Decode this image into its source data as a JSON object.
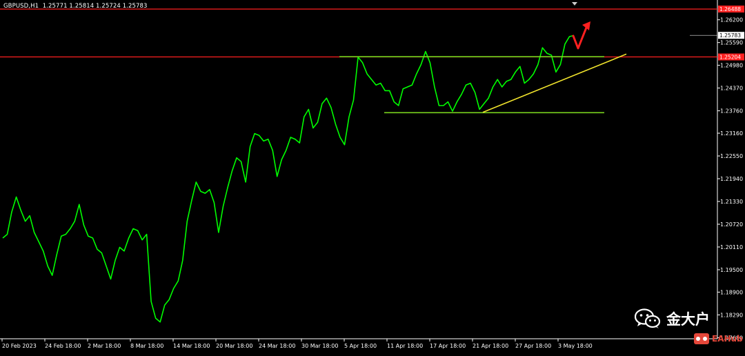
{
  "header": {
    "symbol": "GBPUSD",
    "timeframe": "H1",
    "ohlc": "1.25771 1.25814 1.25724 1.25783"
  },
  "watermark": {
    "main_text": "金大户",
    "sub_text": "EAHub",
    "icon": "wechat-icon"
  },
  "colors": {
    "background": "#000000",
    "price_line": "#00ff00",
    "support_resistance": "#7ad41e",
    "trendline": "#f0e32c",
    "level_line": "#ff2020",
    "arrow": "#ff2020",
    "axis_text": "#ffffff"
  },
  "chart_data": {
    "type": "line",
    "title": "GBPUSD,H1",
    "xlabel": "",
    "ylabel": "",
    "ylim": [
      1.1765,
      1.2649
    ],
    "grid": false,
    "y_ticks": [
      "1.26200",
      "1.25590",
      "1.24980",
      "1.24370",
      "1.23760",
      "1.23160",
      "1.22550",
      "1.21940",
      "1.21330",
      "1.20720",
      "1.20110",
      "1.19500",
      "1.18900",
      "1.18290",
      "1.17680"
    ],
    "x_ticks": [
      "20 Feb 2023",
      "24 Feb 18:00",
      "2 Mar 18:00",
      "8 Mar 18:00",
      "14 Mar 18:00",
      "20 Mar 18:00",
      "24 Mar 18:00",
      "30 Mar 18:00",
      "5 Apr 18:00",
      "11 Apr 18:00",
      "17 Apr 18:00",
      "21 Apr 18:00",
      "27 Apr 18:00",
      "3 May 18:00"
    ],
    "price_labels": [
      {
        "value": 1.26488,
        "text": "1.26488",
        "color": "#ff2020"
      },
      {
        "value": 1.25783,
        "text": "1.25783",
        "color": "#ffffff"
      },
      {
        "value": 1.25204,
        "text": "1.25204",
        "color": "#ff2020"
      }
    ],
    "series": [
      {
        "values": [
          1.2035,
          1.2045,
          1.2105,
          1.2145,
          1.211,
          1.208,
          1.2095,
          1.205,
          1.2025,
          1.2,
          1.196,
          1.1935,
          1.199,
          1.204,
          1.2045,
          1.206,
          1.208,
          1.2125,
          1.207,
          1.204,
          1.2035,
          1.2005,
          1.1995,
          1.196,
          1.1925,
          1.1975,
          1.201,
          1.2,
          1.2035,
          1.206,
          1.2055,
          1.203,
          1.2045,
          1.1865,
          1.182,
          1.181,
          1.1855,
          1.187,
          1.19,
          1.192,
          1.1975,
          1.208,
          1.2135,
          1.2185,
          1.216,
          1.2155,
          1.2165,
          1.213,
          1.205,
          1.212,
          1.217,
          1.2215,
          1.225,
          1.224,
          1.2185,
          1.228,
          1.2315,
          1.231,
          1.2295,
          1.23,
          1.227,
          1.22,
          1.2245,
          1.227,
          1.2305,
          1.23,
          1.229,
          1.236,
          1.238,
          1.233,
          1.2345,
          1.2395,
          1.241,
          1.2385,
          1.234,
          1.2305,
          1.2285,
          1.236,
          1.2405,
          1.252,
          1.2505,
          1.2475,
          1.246,
          1.2445,
          1.245,
          1.243,
          1.243,
          1.24,
          1.239,
          1.2435,
          1.244,
          1.2445,
          1.2475,
          1.25,
          1.2535,
          1.2505,
          1.244,
          1.239,
          1.239,
          1.24,
          1.2375,
          1.24,
          1.242,
          1.2445,
          1.245,
          1.2425,
          1.238,
          1.2395,
          1.241,
          1.244,
          1.246,
          1.244,
          1.2455,
          1.246,
          1.248,
          1.2495,
          1.245,
          1.246,
          1.2475,
          1.25,
          1.2545,
          1.253,
          1.2525,
          1.248,
          1.25,
          1.2555,
          1.2575,
          1.2578
        ]
      }
    ],
    "annotations": {
      "resistance_line": {
        "x_start": 1.25,
        "x_end": 2.1,
        "y": 1.2521
      },
      "support_line": {
        "x_start": 1.6,
        "x_end": 2.1,
        "y": 1.2371
      },
      "trendline": {
        "x_start": 2.0,
        "x_end": 3.0,
        "y_start": 1.2372,
        "y_end": 1.2528
      },
      "level_lines": [
        1.26488,
        1.25204
      ]
    }
  }
}
